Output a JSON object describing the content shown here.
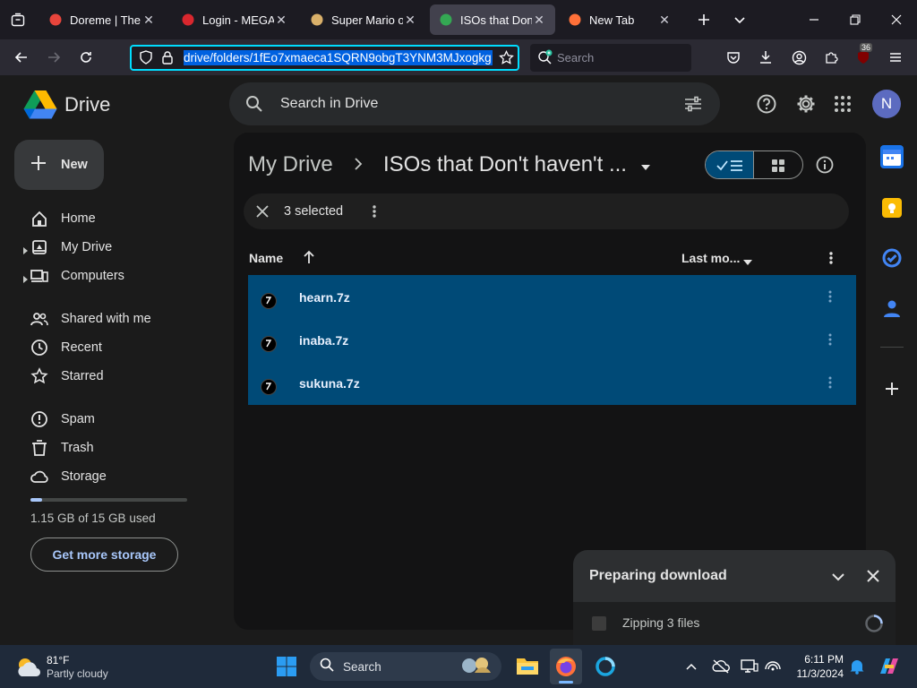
{
  "browser": {
    "tabs": [
      {
        "title": "Doreme | The L",
        "favicon_color": "#e8453c",
        "active": false
      },
      {
        "title": "Login - MEGA",
        "favicon_color": "#d9272e",
        "active": false
      },
      {
        "title": "Super Mario on",
        "favicon_color": "#d9b06a",
        "active": false
      },
      {
        "title": "ISOs that Don't",
        "favicon_color": "#34a853",
        "active": true
      },
      {
        "title": "New Tab",
        "favicon_color": "#ff7139",
        "active": false
      }
    ],
    "url": "drive/folders/1fEo7xmaeca1SQRN9obgT3YNM3MJxogkg",
    "search_placeholder": "Search",
    "extension_badge": "36"
  },
  "drive": {
    "logo_text": "Drive",
    "search_placeholder": "Search in Drive",
    "avatar_letter": "N",
    "new_label": "New",
    "nav": [
      {
        "label": "Home",
        "icon": "home-icon",
        "expand": false
      },
      {
        "label": "My Drive",
        "icon": "my-drive-icon",
        "expand": true
      },
      {
        "label": "Computers",
        "icon": "computers-icon",
        "expand": true
      },
      {
        "label": "Shared with me",
        "icon": "shared-icon",
        "expand": false
      },
      {
        "label": "Recent",
        "icon": "recent-icon",
        "expand": false
      },
      {
        "label": "Starred",
        "icon": "star-icon",
        "expand": false
      },
      {
        "label": "Spam",
        "icon": "spam-icon",
        "expand": false
      },
      {
        "label": "Trash",
        "icon": "trash-icon",
        "expand": false
      },
      {
        "label": "Storage",
        "icon": "cloud-icon",
        "expand": false
      }
    ],
    "storage": {
      "used_text": "1.15 GB of 15 GB used",
      "fraction": 0.077
    },
    "get_storage_label": "Get more storage",
    "breadcrumb": {
      "root": "My Drive",
      "current": "ISOs that Don't haven't ..."
    },
    "selection_text": "3 selected",
    "columns": {
      "name": "Name",
      "modified": "Last mo..."
    },
    "files": [
      "hearn.7z",
      "inaba.7z",
      "sukuna.7z"
    ],
    "download": {
      "title": "Preparing download",
      "status": "Zipping 3 files"
    }
  },
  "taskbar": {
    "weather_temp": "81°F",
    "weather_desc": "Partly cloudy",
    "search_label": "Search",
    "time": "6:11 PM",
    "date": "11/3/2024"
  }
}
